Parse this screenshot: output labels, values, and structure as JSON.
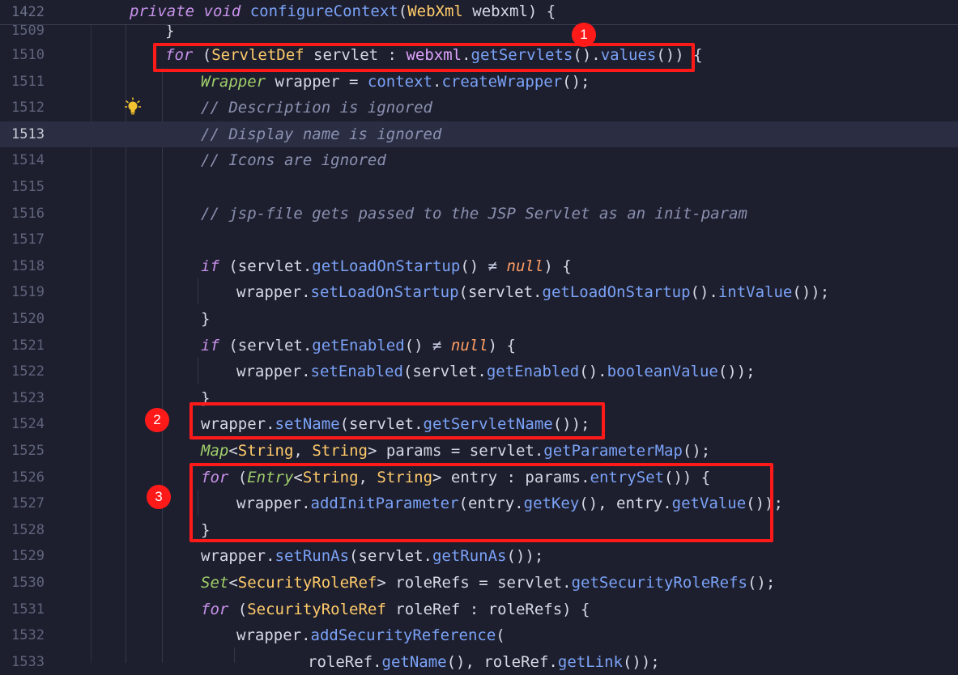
{
  "sticky": {
    "line_number": "1422",
    "text": "private void configureContext(WebXml webxml) {"
  },
  "lines": [
    {
      "n": "1509",
      "text": "}"
    },
    {
      "n": "1510",
      "text": "for (ServletDef servlet : webxml.getServlets().values()) {"
    },
    {
      "n": "1511",
      "text": "Wrapper wrapper = context.createWrapper();"
    },
    {
      "n": "1512",
      "text": "// Description is ignored"
    },
    {
      "n": "1513",
      "text": "// Display name is ignored"
    },
    {
      "n": "1514",
      "text": "// Icons are ignored"
    },
    {
      "n": "1515",
      "text": ""
    },
    {
      "n": "1516",
      "text": "// jsp-file gets passed to the JSP Servlet as an init-param"
    },
    {
      "n": "1517",
      "text": ""
    },
    {
      "n": "1518",
      "text": "if (servlet.getLoadOnStartup() ≠ null) {"
    },
    {
      "n": "1519",
      "text": "wrapper.setLoadOnStartup(servlet.getLoadOnStartup().intValue());"
    },
    {
      "n": "1520",
      "text": "}"
    },
    {
      "n": "1521",
      "text": "if (servlet.getEnabled() ≠ null) {"
    },
    {
      "n": "1522",
      "text": "wrapper.setEnabled(servlet.getEnabled().booleanValue());"
    },
    {
      "n": "1523",
      "text": "}"
    },
    {
      "n": "1524",
      "text": "wrapper.setName(servlet.getServletName());"
    },
    {
      "n": "1525",
      "text": "Map<String, String> params = servlet.getParameterMap();"
    },
    {
      "n": "1526",
      "text": "for (Entry<String, String> entry : params.entrySet()) {"
    },
    {
      "n": "1527",
      "text": "wrapper.addInitParameter(entry.getKey(), entry.getValue());"
    },
    {
      "n": "1528",
      "text": "}"
    },
    {
      "n": "1529",
      "text": "wrapper.setRunAs(servlet.getRunAs());"
    },
    {
      "n": "1530",
      "text": "Set<SecurityRoleRef> roleRefs = servlet.getSecurityRoleRefs();"
    },
    {
      "n": "1531",
      "text": "for (SecurityRoleRef roleRef : roleRefs) {"
    },
    {
      "n": "1532",
      "text": "wrapper.addSecurityReference("
    },
    {
      "n": "1533",
      "text": "roleRef.getName(), roleRef.getLink());"
    }
  ],
  "annotations": [
    {
      "label": "1",
      "target_line": "1510"
    },
    {
      "label": "2",
      "target_line": "1524"
    },
    {
      "label": "3",
      "target_line": "1526-1528"
    }
  ],
  "current_line": "1513",
  "icons": {
    "gutter": "lightbulb-icon"
  },
  "colors": {
    "background": "#1e1f2e",
    "keyword": "#c792ea",
    "type": "#ffcb6b",
    "method": "#7aa2f7",
    "comment": "#8a90b0",
    "highlight_box": "#ff1a1a"
  }
}
